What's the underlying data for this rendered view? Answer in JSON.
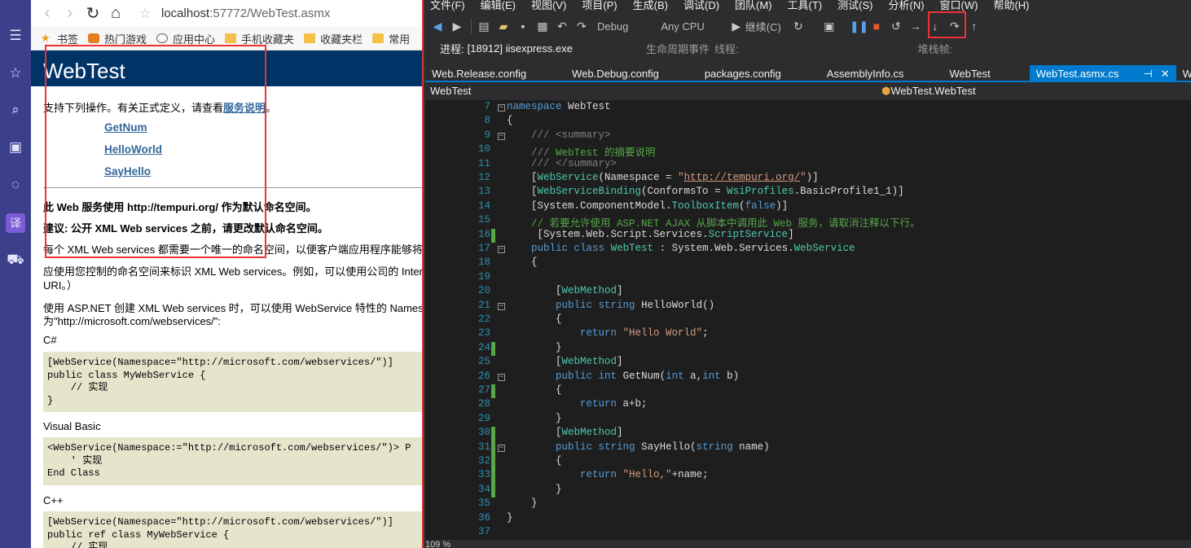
{
  "browser": {
    "url_host": "localhost",
    "url_path": ":57772/WebTest.asmx",
    "bookmarks": [
      "书签",
      "热门游戏",
      "应用中心",
      "手机收藏夹",
      "收藏夹栏",
      "常用"
    ],
    "page_title": "WebTest",
    "intro": "支持下列操作。有关正式定义，请查看",
    "intro_link": "服务说明",
    "intro_end": "。",
    "operations": [
      "GetNum",
      "HelloWorld",
      "SayHello"
    ],
    "ns_note": "此 Web 服务使用 http://tempuri.org/ 作为默认命名空间。",
    "advice": "建议: 公开 XML Web services 之前，请更改默认命名空间。",
    "para1": "每个 XML Web services 都需要一个唯一的命名空间，以便客户端应用程序能够将它与",
    "para2a": "应使用您控制的命名空间来标识 XML Web services。例如，可以使用公司的 Internet",
    "para2b": "URI。）",
    "para3a": "使用 ASP.NET 创建 XML Web services 时，可以使用 WebService 特性的 Namespa",
    "para3b": "为\"http://microsoft.com/webservices/\":",
    "lang_cs": "C#",
    "code_cs": "[WebService(Namespace=\"http://microsoft.com/webservices/\")]\npublic class MyWebService {\n    // 实现\n}",
    "lang_vb": "Visual Basic",
    "code_vb": "<WebService(Namespace:=\"http://microsoft.com/webservices/\")> P\n    ' 实现\nEnd Class",
    "lang_cpp": "C++",
    "code_cpp": "[WebService(Namespace=\"http://microsoft.com/webservices/\")]\npublic ref class MyWebService {\n    // 实现"
  },
  "vs": {
    "menu": [
      "文件(F)",
      "编辑(E)",
      "视图(V)",
      "项目(P)",
      "生成(B)",
      "调试(D)",
      "团队(M)",
      "工具(T)",
      "测试(S)",
      "分析(N)",
      "窗口(W)",
      "帮助(H)"
    ],
    "toolbar": {
      "config": "Debug",
      "platform": "Any CPU",
      "continue": "继续(C)"
    },
    "process_label": "进程:",
    "process_value": "[18912] iisexpress.exe",
    "lifecycle": "生命周期事件",
    "thread": "线程:",
    "stackframe": "堆栈帧:",
    "tabs": [
      "Web.Release.config",
      "Web.Debug.config",
      "packages.config",
      "AssemblyInfo.cs",
      "WebTest",
      "WebTest.asmx.cs",
      "Web"
    ],
    "nav_left": "WebTest",
    "nav_right": "WebTest.WebTest",
    "zoom": "109 %",
    "line_numbers": [
      "7",
      "8",
      "9",
      "10",
      "11",
      "12",
      "13",
      "14",
      "15",
      "16",
      "17",
      "18",
      "19",
      "20",
      "21",
      "22",
      "23",
      "24",
      "25",
      "26",
      "27",
      "28",
      "29",
      "30",
      "31",
      "32",
      "33",
      "34",
      "35",
      "36",
      "37"
    ]
  }
}
